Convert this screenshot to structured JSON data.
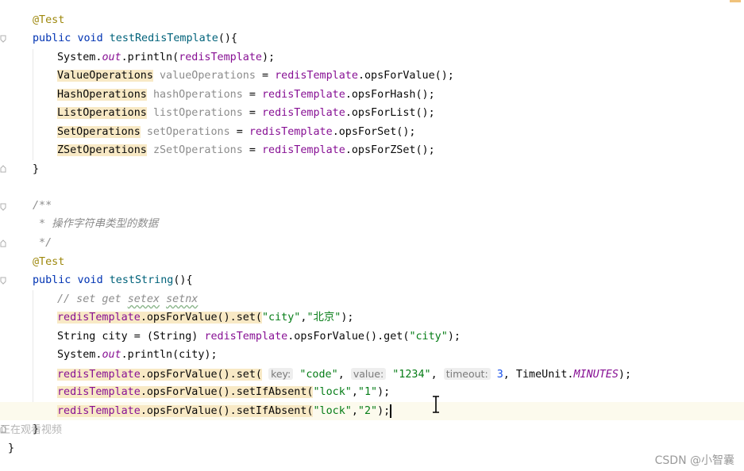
{
  "editor": {
    "lines": {
      "l1": {
        "annot": "@Test"
      },
      "l2": {
        "kw1": "public",
        "kw2": "void",
        "fn": "testRedisTemplate",
        "rest": "(){"
      },
      "l3": {
        "a": "System.",
        "field": "out",
        "b": ".println(",
        "var": "redisTemplate",
        "c": ");"
      },
      "l4": {
        "type": "ValueOperations",
        "name": "valueOperations",
        "eq": " = ",
        "var": "redisTemplate",
        "call": ".opsForValue();"
      },
      "l5": {
        "type": "HashOperations",
        "name": "hashOperations",
        "eq": " = ",
        "var": "redisTemplate",
        "call": ".opsForHash();"
      },
      "l6": {
        "type": "ListOperations",
        "name": "listOperations",
        "eq": " = ",
        "var": "redisTemplate",
        "call": ".opsForList();"
      },
      "l7": {
        "type": "SetOperations",
        "name": "setOperations",
        "eq": " = ",
        "var": "redisTemplate",
        "call": ".opsForSet();"
      },
      "l8": {
        "type": "ZSetOperations",
        "name": "zSetOperations",
        "eq": " = ",
        "var": "redisTemplate",
        "call": ".opsForZSet();"
      },
      "l9": {
        "text": "}"
      },
      "l10": {
        "text": "/**"
      },
      "l11": {
        "text": " * 操作字符串类型的数据"
      },
      "l12": {
        "text": " */"
      },
      "l13": {
        "annot": "@Test"
      },
      "l14": {
        "kw1": "public",
        "kw2": "void",
        "fn": "testString",
        "rest": "(){"
      },
      "l15": {
        "c1": "// set get ",
        "w1": "setex",
        "w2": "setnx"
      },
      "l16": {
        "var": "redisTemplate",
        "a": ".opsForValue().set(",
        "s1": "\"city\"",
        "comma": ",",
        "s2": "\"北京\"",
        "end": ");"
      },
      "l17": {
        "a": "String city = (String) ",
        "var": "redisTemplate",
        "b": ".opsForValue().get(",
        "s1": "\"city\"",
        "end": ");"
      },
      "l18": {
        "a": "System.",
        "field": "out",
        "b": ".println(city);"
      },
      "l19": {
        "var": "redisTemplate",
        "a": ".opsForValue().set(",
        "h1": "key:",
        "s1": "\"code\"",
        "h2": "value:",
        "s2": "\"1234\"",
        "h3": "timeout:",
        "num": "3",
        "b": ", TimeUnit.",
        "enum": "MINUTES",
        "end": ");"
      },
      "l20": {
        "var": "redisTemplate",
        "a": ".opsForValue().setIfAbsent(",
        "s1": "\"lock\"",
        "comma": ",",
        "s2": "\"1\"",
        "end": ");"
      },
      "l21": {
        "var": "redisTemplate",
        "a": ".opsForValue().setIfAbsent(",
        "s1": "\"lock\"",
        "comma": ",",
        "s2": "\"2\"",
        "end": ");"
      },
      "l22": {
        "text": "}"
      },
      "l23": {
        "text": "}"
      }
    }
  },
  "overlay": {
    "status": "正在观看视频"
  },
  "watermark": {
    "text": "CSDN @小智囊"
  }
}
